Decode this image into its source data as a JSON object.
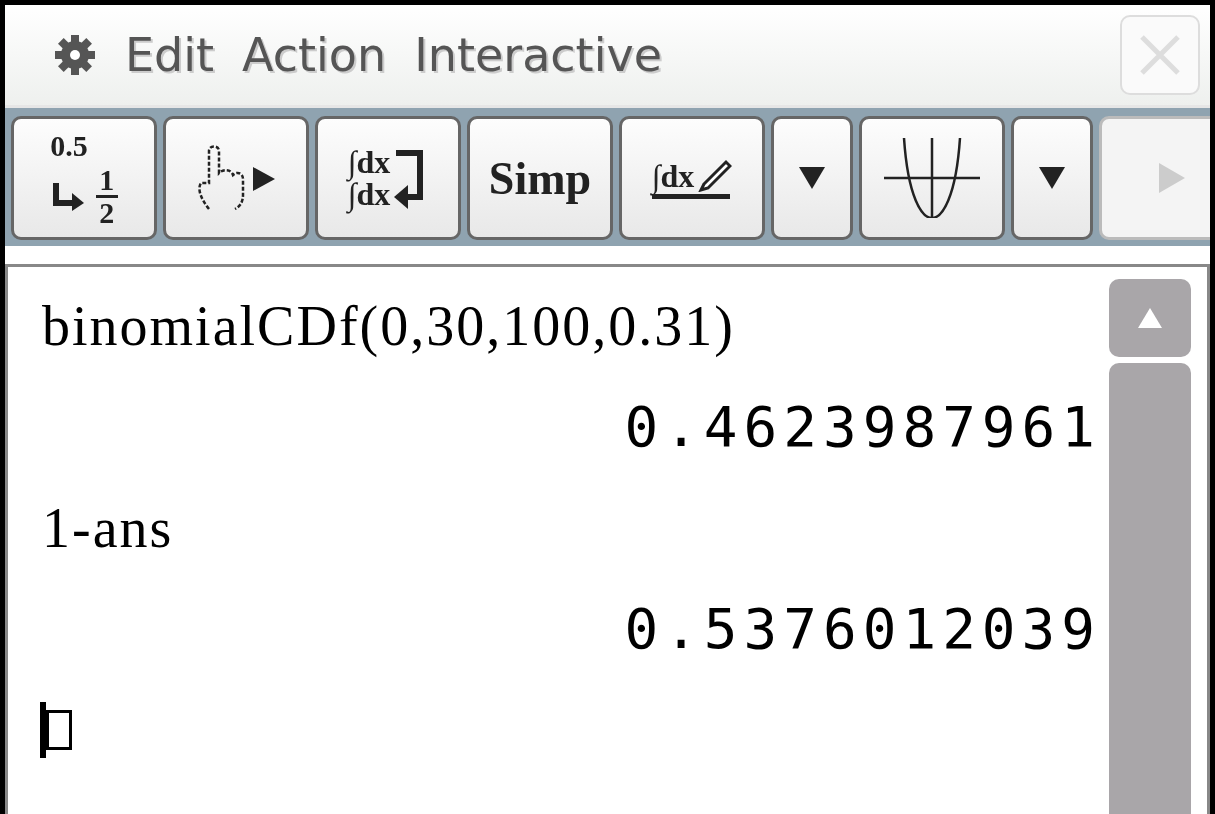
{
  "menu_bar": {
    "items": [
      {
        "kind": "settings"
      },
      {
        "kind": "text",
        "label": "Edit"
      },
      {
        "kind": "text",
        "label": "Action"
      },
      {
        "kind": "text",
        "label": "Interactive"
      }
    ],
    "close": {
      "disabled": true
    }
  },
  "toolbar": [
    {
      "kind": "convert",
      "decimal": "0.5",
      "numerator": "1",
      "denominator": "2",
      "disabled": false
    },
    {
      "kind": "hand",
      "disabled": false
    },
    {
      "kind": "integral-toggle",
      "top": "∫dx",
      "bottom": "∫dx",
      "disabled": false
    },
    {
      "kind": "text",
      "label": "Simp",
      "disabled": false
    },
    {
      "kind": "integral-pen",
      "label": "∫dx",
      "disabled": false
    },
    {
      "kind": "dropdown",
      "disabled": false
    },
    {
      "kind": "graph",
      "disabled": false
    },
    {
      "kind": "dropdown",
      "disabled": false
    },
    {
      "kind": "next",
      "disabled": true
    }
  ],
  "work_area": {
    "entries": [
      {
        "input": "binomialCDf(0,30,100,0.31)",
        "output": "0.4623987961"
      },
      {
        "input": "1-ans",
        "output": "0.5376012039"
      }
    ],
    "cursor_line": {
      "empty_box": true
    }
  }
}
